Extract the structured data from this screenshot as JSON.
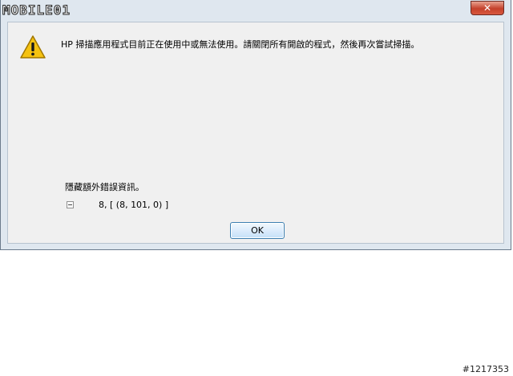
{
  "titlebar": {
    "logo_text": "MOBILE01",
    "close_label": "✕"
  },
  "dialog": {
    "icon": "warning-icon",
    "message": "HP 掃描應用程式目前正在使用中或無法使用。請關閉所有開啟的程式，然後再次嘗試掃描。",
    "details_label": "隱藏額外錯誤資訊。",
    "details_value": "8, [ (8, 101, 0) ]",
    "ok_label": "OK"
  },
  "watermark": "#1217353",
  "colors": {
    "window_frame": "#dfe7ef",
    "client": "#f0f0f0",
    "close_button": "#c4412b",
    "warning": "#f5c211"
  }
}
